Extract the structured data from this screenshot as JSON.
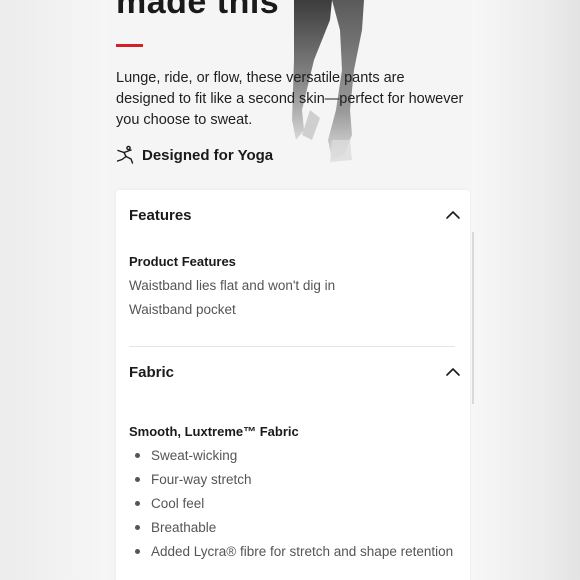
{
  "hero": {
    "headline": "made this",
    "description": "Lunge, ride, or flow, these versatile pants are designed to fit like a second skin—perfect for however you choose to sweat.",
    "activity": {
      "icon": "yoga-pose-icon",
      "label": "Designed for Yoga"
    }
  },
  "accordion": {
    "features": {
      "title": "Features",
      "expanded": true,
      "icon": "chevron-up-icon",
      "subtitle": "Product Features",
      "items": [
        "Waistband lies flat and won't dig in",
        "Waistband pocket"
      ]
    },
    "fabric": {
      "title": "Fabric",
      "expanded": true,
      "icon": "chevron-up-icon",
      "subtitle": "Smooth, Luxtreme™ Fabric",
      "items": [
        "Sweat-wicking",
        "Four-way stretch",
        "Cool feel",
        "Breathable",
        "Added Lycra® fibre for stretch and shape retention"
      ]
    }
  },
  "colors": {
    "accent": "#d31f28",
    "text": "#1a1a1a",
    "muted": "#555555",
    "background": "#f5f5f5",
    "card": "#ffffff"
  }
}
